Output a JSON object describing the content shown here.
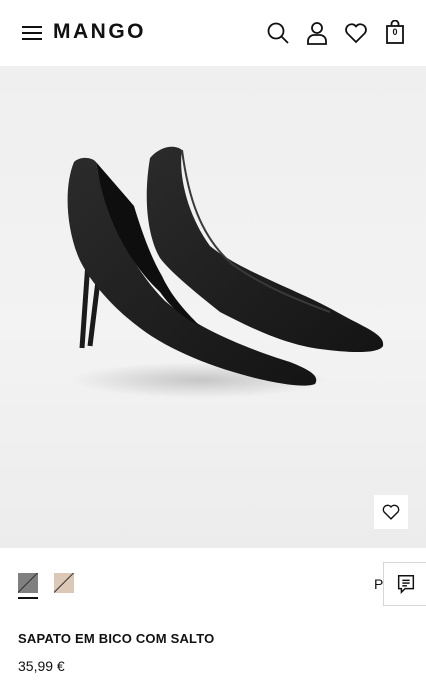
{
  "header": {
    "brand": "MANGO",
    "icons": [
      "menu-icon",
      "search-icon",
      "user-icon",
      "heart-icon",
      "bag-icon"
    ],
    "cart_count": "0"
  },
  "gallery": {
    "image": "black-pointed-pumps",
    "slide_count": 4,
    "active_slide": 2,
    "wishlist_icon": "heart-icon"
  },
  "colors": {
    "options": [
      {
        "name": "black",
        "hex": "#808080",
        "selected": true
      },
      {
        "name": "nude",
        "hex": "#dcc8b6",
        "selected": false
      }
    ]
  },
  "size_hint": "P",
  "chat_icon": "chat-icon",
  "product": {
    "name": "SAPATO EM BICO COM SALTO",
    "price": "35,99 €"
  }
}
